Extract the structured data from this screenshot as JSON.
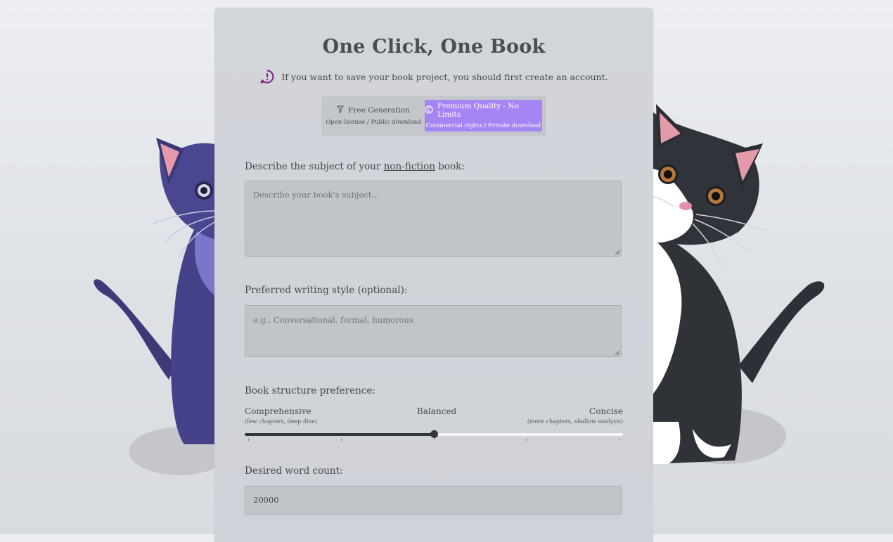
{
  "app": {
    "title": "One Click, One Book",
    "notice": "If you want to save your book project, you should first create an account."
  },
  "modes": {
    "free": {
      "label": "Free Generation",
      "sublabel": "Open-license / Public download",
      "icon": "funnel-icon",
      "selected": false
    },
    "premium": {
      "label": "Premium Quality - No Limits",
      "sublabel": "Commercial rights / Private download",
      "icon": "copyright-icon",
      "selected": true
    }
  },
  "subject": {
    "label_prefix": "Describe the subject of your ",
    "label_link": "non-fiction",
    "label_suffix": " book:",
    "placeholder": "Describe your book's subject..."
  },
  "style": {
    "label": "Preferred writing style (optional):",
    "placeholder": "e.g., Conversational, formal, humorous"
  },
  "structure": {
    "label": "Book structure preference:",
    "left_label": "Comprehensive",
    "left_sub": "(few chapters, deep dive)",
    "middle_label": "Balanced",
    "right_label": "Concise",
    "right_sub": "(more chapters, shallow analysis)",
    "value": 0.5
  },
  "word_count": {
    "label": "Desired word count:",
    "value": "20000"
  },
  "colors": {
    "accent": "#a585f3",
    "notice_icon": "#7a1f86",
    "slider": "#33363a"
  }
}
